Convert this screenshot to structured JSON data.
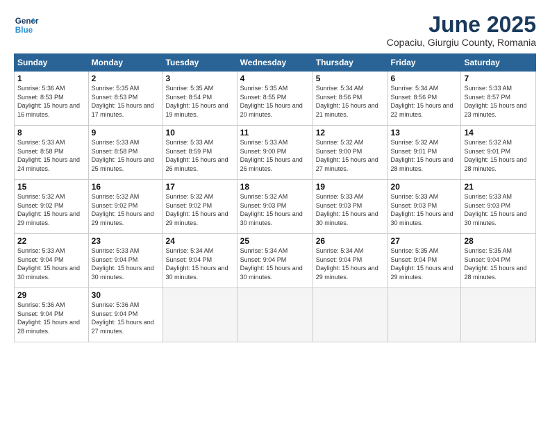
{
  "logo": {
    "line1": "General",
    "line2": "Blue"
  },
  "title": "June 2025",
  "location": "Copaciu, Giurgiu County, Romania",
  "weekdays": [
    "Sunday",
    "Monday",
    "Tuesday",
    "Wednesday",
    "Thursday",
    "Friday",
    "Saturday"
  ],
  "weeks": [
    [
      {
        "day": "1",
        "sunrise": "Sunrise: 5:36 AM",
        "sunset": "Sunset: 8:53 PM",
        "daylight": "Daylight: 15 hours and 16 minutes."
      },
      {
        "day": "2",
        "sunrise": "Sunrise: 5:35 AM",
        "sunset": "Sunset: 8:53 PM",
        "daylight": "Daylight: 15 hours and 17 minutes."
      },
      {
        "day": "3",
        "sunrise": "Sunrise: 5:35 AM",
        "sunset": "Sunset: 8:54 PM",
        "daylight": "Daylight: 15 hours and 19 minutes."
      },
      {
        "day": "4",
        "sunrise": "Sunrise: 5:35 AM",
        "sunset": "Sunset: 8:55 PM",
        "daylight": "Daylight: 15 hours and 20 minutes."
      },
      {
        "day": "5",
        "sunrise": "Sunrise: 5:34 AM",
        "sunset": "Sunset: 8:56 PM",
        "daylight": "Daylight: 15 hours and 21 minutes."
      },
      {
        "day": "6",
        "sunrise": "Sunrise: 5:34 AM",
        "sunset": "Sunset: 8:56 PM",
        "daylight": "Daylight: 15 hours and 22 minutes."
      },
      {
        "day": "7",
        "sunrise": "Sunrise: 5:33 AM",
        "sunset": "Sunset: 8:57 PM",
        "daylight": "Daylight: 15 hours and 23 minutes."
      }
    ],
    [
      {
        "day": "8",
        "sunrise": "Sunrise: 5:33 AM",
        "sunset": "Sunset: 8:58 PM",
        "daylight": "Daylight: 15 hours and 24 minutes."
      },
      {
        "day": "9",
        "sunrise": "Sunrise: 5:33 AM",
        "sunset": "Sunset: 8:58 PM",
        "daylight": "Daylight: 15 hours and 25 minutes."
      },
      {
        "day": "10",
        "sunrise": "Sunrise: 5:33 AM",
        "sunset": "Sunset: 8:59 PM",
        "daylight": "Daylight: 15 hours and 26 minutes."
      },
      {
        "day": "11",
        "sunrise": "Sunrise: 5:33 AM",
        "sunset": "Sunset: 9:00 PM",
        "daylight": "Daylight: 15 hours and 26 minutes."
      },
      {
        "day": "12",
        "sunrise": "Sunrise: 5:32 AM",
        "sunset": "Sunset: 9:00 PM",
        "daylight": "Daylight: 15 hours and 27 minutes."
      },
      {
        "day": "13",
        "sunrise": "Sunrise: 5:32 AM",
        "sunset": "Sunset: 9:01 PM",
        "daylight": "Daylight: 15 hours and 28 minutes."
      },
      {
        "day": "14",
        "sunrise": "Sunrise: 5:32 AM",
        "sunset": "Sunset: 9:01 PM",
        "daylight": "Daylight: 15 hours and 28 minutes."
      }
    ],
    [
      {
        "day": "15",
        "sunrise": "Sunrise: 5:32 AM",
        "sunset": "Sunset: 9:02 PM",
        "daylight": "Daylight: 15 hours and 29 minutes."
      },
      {
        "day": "16",
        "sunrise": "Sunrise: 5:32 AM",
        "sunset": "Sunset: 9:02 PM",
        "daylight": "Daylight: 15 hours and 29 minutes."
      },
      {
        "day": "17",
        "sunrise": "Sunrise: 5:32 AM",
        "sunset": "Sunset: 9:02 PM",
        "daylight": "Daylight: 15 hours and 29 minutes."
      },
      {
        "day": "18",
        "sunrise": "Sunrise: 5:32 AM",
        "sunset": "Sunset: 9:03 PM",
        "daylight": "Daylight: 15 hours and 30 minutes."
      },
      {
        "day": "19",
        "sunrise": "Sunrise: 5:33 AM",
        "sunset": "Sunset: 9:03 PM",
        "daylight": "Daylight: 15 hours and 30 minutes."
      },
      {
        "day": "20",
        "sunrise": "Sunrise: 5:33 AM",
        "sunset": "Sunset: 9:03 PM",
        "daylight": "Daylight: 15 hours and 30 minutes."
      },
      {
        "day": "21",
        "sunrise": "Sunrise: 5:33 AM",
        "sunset": "Sunset: 9:03 PM",
        "daylight": "Daylight: 15 hours and 30 minutes."
      }
    ],
    [
      {
        "day": "22",
        "sunrise": "Sunrise: 5:33 AM",
        "sunset": "Sunset: 9:04 PM",
        "daylight": "Daylight: 15 hours and 30 minutes."
      },
      {
        "day": "23",
        "sunrise": "Sunrise: 5:33 AM",
        "sunset": "Sunset: 9:04 PM",
        "daylight": "Daylight: 15 hours and 30 minutes."
      },
      {
        "day": "24",
        "sunrise": "Sunrise: 5:34 AM",
        "sunset": "Sunset: 9:04 PM",
        "daylight": "Daylight: 15 hours and 30 minutes."
      },
      {
        "day": "25",
        "sunrise": "Sunrise: 5:34 AM",
        "sunset": "Sunset: 9:04 PM",
        "daylight": "Daylight: 15 hours and 30 minutes."
      },
      {
        "day": "26",
        "sunrise": "Sunrise: 5:34 AM",
        "sunset": "Sunset: 9:04 PM",
        "daylight": "Daylight: 15 hours and 29 minutes."
      },
      {
        "day": "27",
        "sunrise": "Sunrise: 5:35 AM",
        "sunset": "Sunset: 9:04 PM",
        "daylight": "Daylight: 15 hours and 29 minutes."
      },
      {
        "day": "28",
        "sunrise": "Sunrise: 5:35 AM",
        "sunset": "Sunset: 9:04 PM",
        "daylight": "Daylight: 15 hours and 28 minutes."
      }
    ],
    [
      {
        "day": "29",
        "sunrise": "Sunrise: 5:36 AM",
        "sunset": "Sunset: 9:04 PM",
        "daylight": "Daylight: 15 hours and 28 minutes."
      },
      {
        "day": "30",
        "sunrise": "Sunrise: 5:36 AM",
        "sunset": "Sunset: 9:04 PM",
        "daylight": "Daylight: 15 hours and 27 minutes."
      },
      null,
      null,
      null,
      null,
      null
    ]
  ]
}
